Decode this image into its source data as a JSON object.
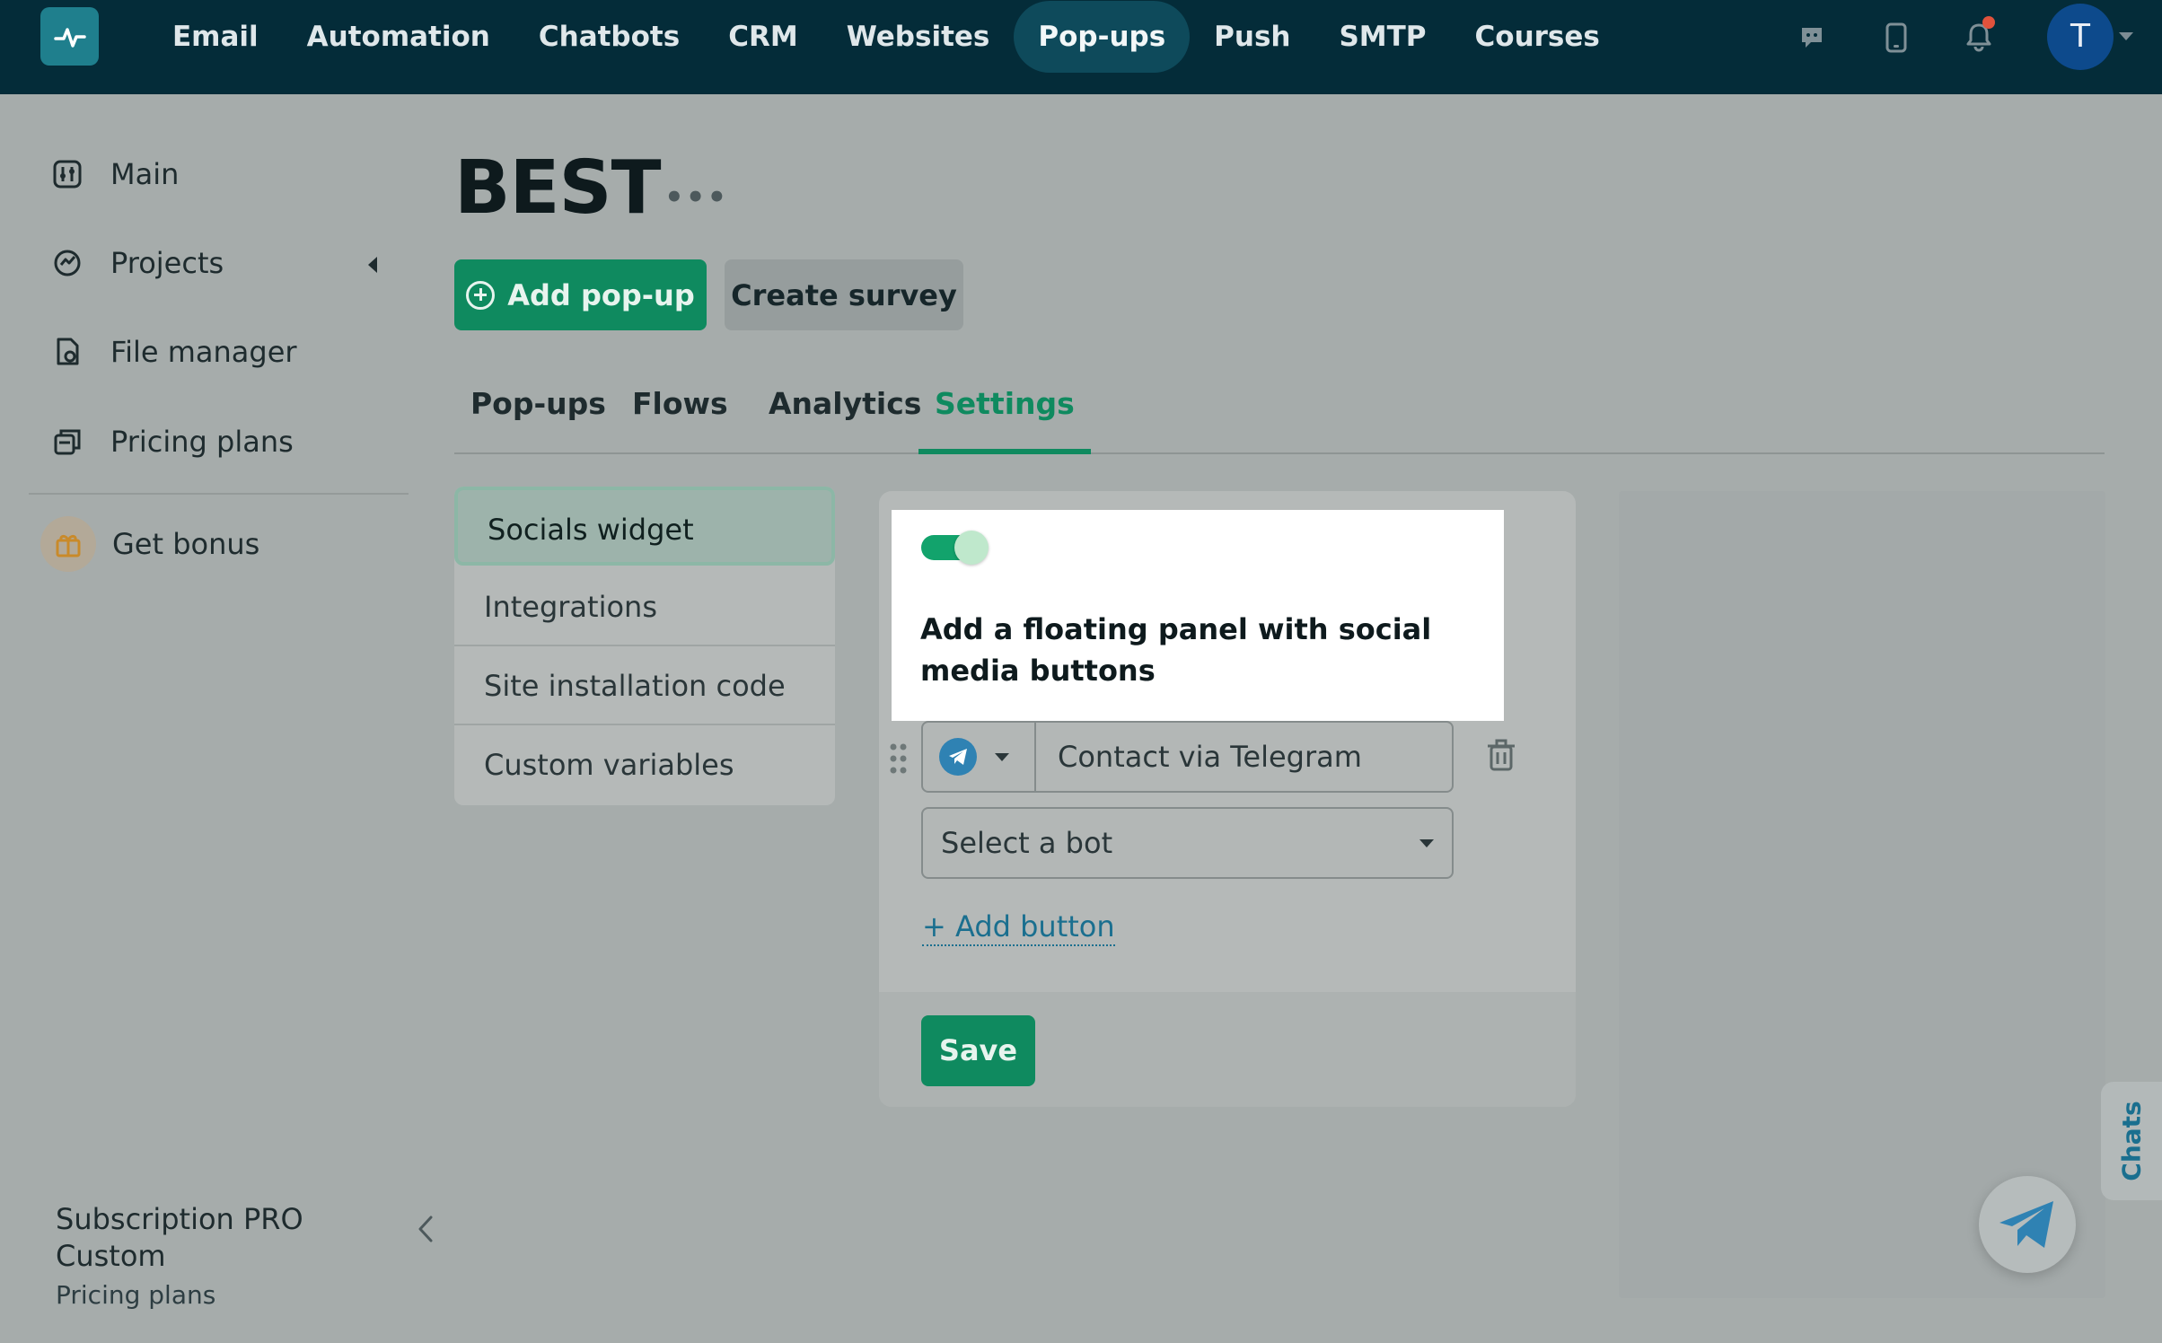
{
  "nav": {
    "items": [
      {
        "label": "Email"
      },
      {
        "label": "Automation"
      },
      {
        "label": "Chatbots"
      },
      {
        "label": "CRM"
      },
      {
        "label": "Websites"
      },
      {
        "label": "Pop-ups",
        "active": true
      },
      {
        "label": "Push"
      },
      {
        "label": "SMTP"
      },
      {
        "label": "Courses"
      }
    ],
    "avatar_initial": "T",
    "icons": [
      "chat-icon",
      "mobile-icon",
      "bell-icon"
    ]
  },
  "sidebar": {
    "items": [
      {
        "label": "Main",
        "icon": "dashboard-icon"
      },
      {
        "label": "Projects",
        "icon": "projects-icon"
      },
      {
        "label": "File manager",
        "icon": "file-icon"
      },
      {
        "label": "Pricing plans",
        "icon": "pricing-icon"
      }
    ],
    "bonus": {
      "label": "Get bonus",
      "icon": "gift-icon"
    },
    "subscription": {
      "title": "Subscription PRO Custom",
      "link": "Pricing plans"
    }
  },
  "page": {
    "title": "BEST",
    "more": "•••",
    "add_popup_label": "Add pop-up",
    "create_survey_label": "Create survey"
  },
  "tabs": [
    {
      "label": "Pop-ups"
    },
    {
      "label": "Flows"
    },
    {
      "label": "Analytics"
    },
    {
      "label": "Settings",
      "active": true
    }
  ],
  "settings_menu": [
    {
      "label": "Socials widget",
      "active": true
    },
    {
      "label": "Integrations"
    },
    {
      "label": "Site installation code"
    },
    {
      "label": "Custom variables"
    }
  ],
  "widget": {
    "toggle_on": true,
    "heading": "Add a floating panel with social media buttons",
    "social_button": {
      "network": "telegram-icon",
      "text": "Contact via Telegram"
    },
    "bot_select": "Select a bot",
    "add_button_label": "+ Add button",
    "save_label": "Save"
  },
  "chats_label": "Chats",
  "colors": {
    "topbar": "#042c39",
    "accent_green": "#0f8a5f",
    "link_blue": "#1a6f8f",
    "notification": "#e0523c"
  }
}
